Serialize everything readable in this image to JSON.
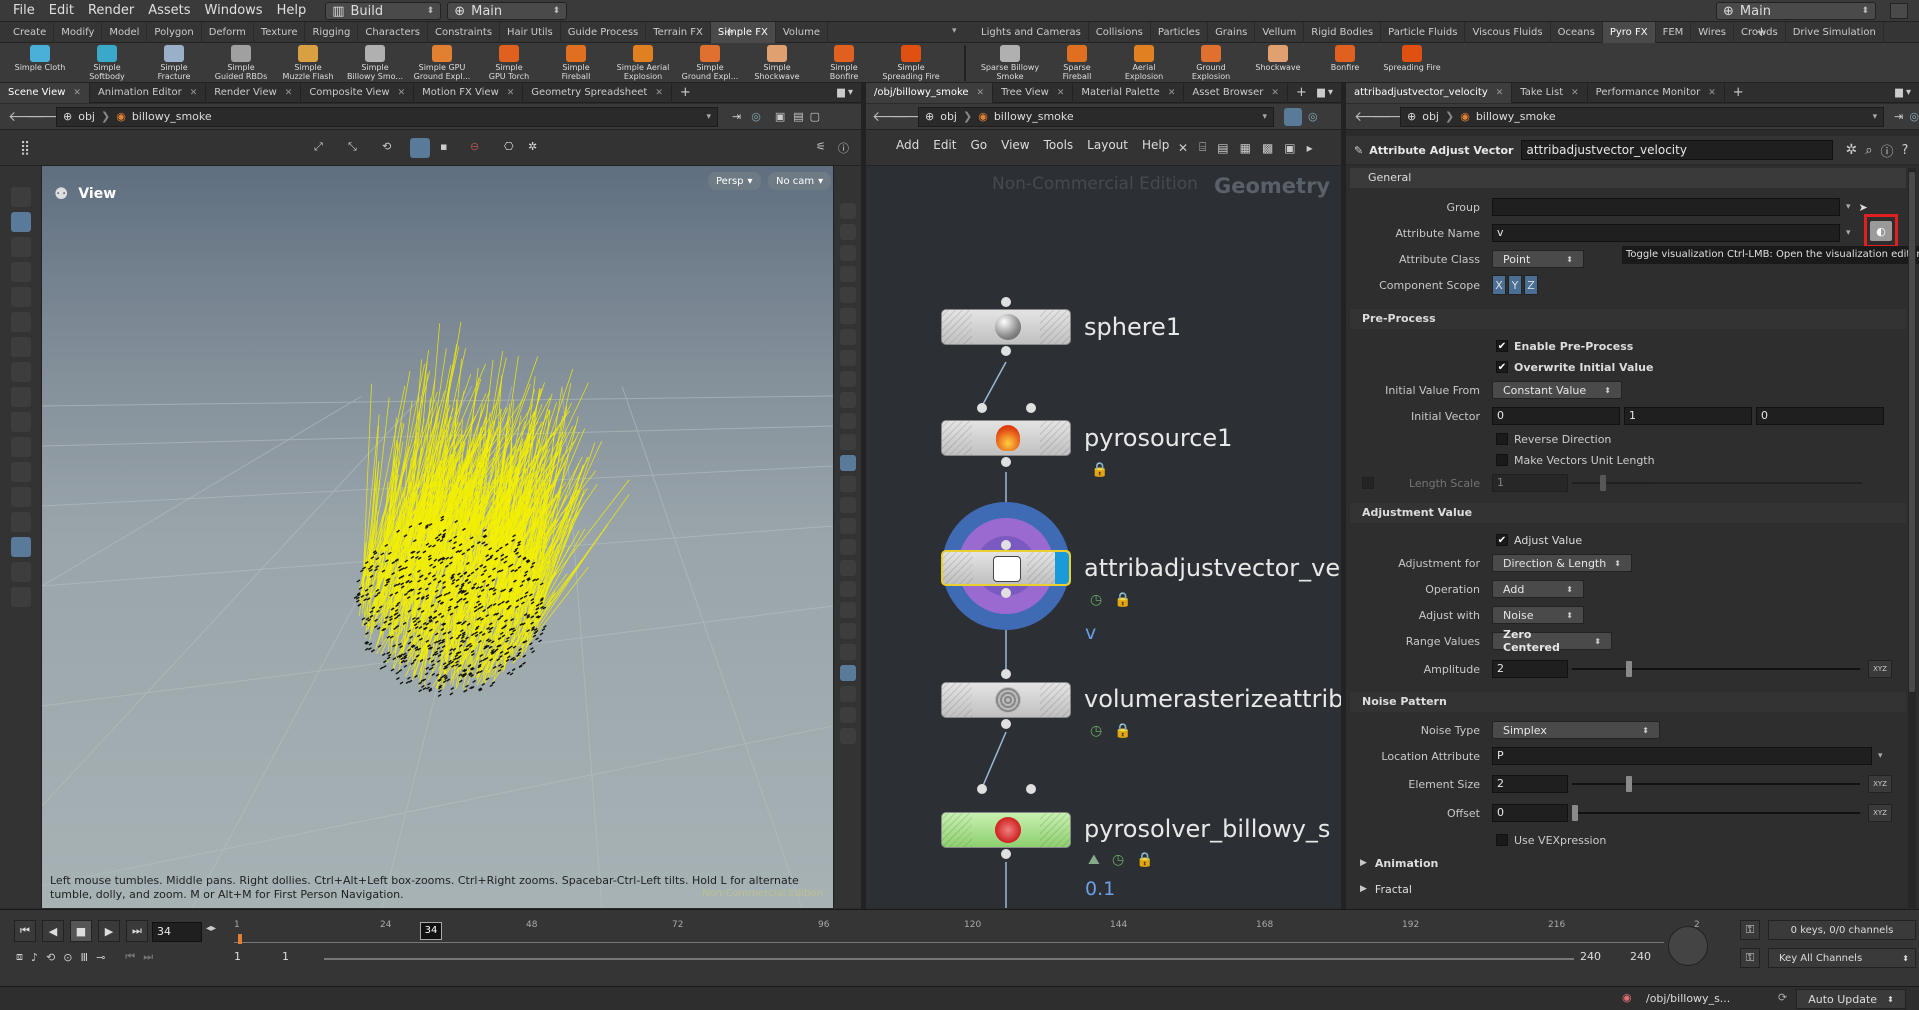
{
  "menubar": {
    "items": [
      "File",
      "Edit",
      "Render",
      "Assets",
      "Windows",
      "Help"
    ],
    "desktop": "Build",
    "network": "Main",
    "right_desktop": "Main"
  },
  "shelf_tabs_left": [
    "Create",
    "Modify",
    "Model",
    "Polygon",
    "Deform",
    "Texture",
    "Rigging",
    "Characters",
    "Constraints",
    "Hair Utils",
    "Guide Process",
    "Terrain FX",
    "Simple FX",
    "Volume"
  ],
  "shelf_tabs_left_active": "Simple FX",
  "shelf_tabs_right": [
    "Lights and Cameras",
    "Collisions",
    "Particles",
    "Grains",
    "Vellum",
    "Rigid Bodies",
    "Particle Fluids",
    "Viscous Fluids",
    "Oceans",
    "Pyro FX",
    "FEM",
    "Wires",
    "Crowds",
    "Drive Simulation"
  ],
  "shelf_tabs_right_active": "Pyro FX",
  "shelf_tools_left": [
    {
      "label": "Simple Cloth",
      "color": "#4ab0d8"
    },
    {
      "label": "Simple\nSoftbody",
      "color": "#3aa8c8"
    },
    {
      "label": "Simple\nFracture",
      "color": "#9ab0c8"
    },
    {
      "label": "Simple\nGuided RBDs",
      "color": "#a0a0a0"
    },
    {
      "label": "Simple\nMuzzle Flash",
      "color": "#d8a040"
    },
    {
      "label": "Simple\nBillowy Smo...",
      "color": "#b0b0b0"
    },
    {
      "label": "Simple GPU\nGround Expl...",
      "color": "#e08030"
    },
    {
      "label": "Simple\nGPU Torch",
      "color": "#e06020"
    },
    {
      "label": "Simple\nFireball",
      "color": "#e07020"
    },
    {
      "label": "Simple Aerial\nExplosion",
      "color": "#e08020"
    },
    {
      "label": "Simple\nGround Expl...",
      "color": "#e07030"
    },
    {
      "label": "Simple\nShockwave",
      "color": "#e0a070"
    },
    {
      "label": "Simple\nBonfire",
      "color": "#e06020"
    },
    {
      "label": "Simple\nSpreading Fire",
      "color": "#e05010"
    }
  ],
  "shelf_tools_right": [
    {
      "label": "Sparse Billowy\nSmoke",
      "color": "#b0b0b0"
    },
    {
      "label": "Sparse\nFireball",
      "color": "#e07020"
    },
    {
      "label": "Aerial\nExplosion",
      "color": "#e08020"
    },
    {
      "label": "Ground\nExplosion",
      "color": "#e07030"
    },
    {
      "label": "Shockwave",
      "color": "#e0a070"
    },
    {
      "label": "Bonfire",
      "color": "#e06020"
    },
    {
      "label": "Spreading Fire",
      "color": "#e05010"
    }
  ],
  "left_pane": {
    "tabs": [
      "Scene View",
      "Animation Editor",
      "Render View",
      "Composite View",
      "Motion FX View",
      "Geometry Spreadsheet"
    ],
    "active_tab": "Scene View",
    "path_root": "obj",
    "path_node": "billowy_smoke",
    "viewport_label": "View",
    "persp": "Persp",
    "cam": "No cam",
    "help_text": "Left mouse tumbles. Middle pans. Right dollies. Ctrl+Alt+Left box-zooms. Ctrl+Right zooms. Spacebar-Ctrl-Left tilts. Hold L for alternate tumble, dolly, and zoom. M or Alt+M for First Person Navigation.",
    "watermark": "Non-Commercial Edition"
  },
  "mid_pane": {
    "tabs": [
      "/obj/billowy_smoke",
      "Tree View",
      "Material Palette",
      "Asset Browser"
    ],
    "active_tab": "/obj/billowy_smoke",
    "path_root": "obj",
    "path_node": "billowy_smoke",
    "menu": [
      "Add",
      "Edit",
      "Go",
      "View",
      "Tools",
      "Layout",
      "Help"
    ],
    "watermark": "Non-Commercial Edition",
    "context": "Geometry",
    "nodes": [
      {
        "name": "sphere1",
        "sub": ""
      },
      {
        "name": "pyrosource1",
        "sub": ""
      },
      {
        "name": "attribadjustvector_ve",
        "sub": "v"
      },
      {
        "name": "volumerasterizeattrib",
        "sub": ""
      },
      {
        "name": "pyrosolver_billowy_s",
        "sub": "0.1"
      }
    ]
  },
  "right_pane": {
    "tabs": [
      "attribadjustvector_velocity",
      "Take List",
      "Performance Monitor"
    ],
    "active_tab": "attribadjustvector_velocity",
    "path_root": "obj",
    "path_node": "billowy_smoke",
    "node_type": "Attribute Adjust Vector",
    "node_name": "attribadjustvector_velocity",
    "tab_general": "General",
    "group_label": "Group",
    "group_value": "",
    "attrname_label": "Attribute Name",
    "attrname_value": "v",
    "tooltip": "Toggle visualization Ctrl-LMB: Open the visualization editor",
    "attrclass_label": "Attribute Class",
    "attrclass_value": "Point",
    "compscope_label": "Component Scope",
    "comps": [
      "X",
      "Y",
      "Z"
    ],
    "preprocess": "Pre-Process",
    "enable_pre": "Enable Pre-Process",
    "overwrite": "Overwrite Initial Value",
    "initfrom_label": "Initial Value From",
    "initfrom_value": "Constant Value",
    "initvec_label": "Initial Vector",
    "initvec": [
      "0",
      "1",
      "0"
    ],
    "reverse": "Reverse Direction",
    "unitlen": "Make Vectors Unit Length",
    "lenscale_label": "Length Scale",
    "lenscale_value": "1",
    "adjval": "Adjustment Value",
    "adjust_value": "Adjust Value",
    "adjfor_label": "Adjustment for",
    "adjfor_value": "Direction & Length",
    "op_label": "Operation",
    "op_value": "Add",
    "adjwith_label": "Adjust with",
    "adjwith_value": "Noise",
    "range_label": "Range Values",
    "range_value": "Zero Centered",
    "amp_label": "Amplitude",
    "amp_value": "2",
    "noisepat": "Noise Pattern",
    "ntype_label": "Noise Type",
    "ntype_value": "Simplex",
    "locattr_label": "Location Attribute",
    "locattr_value": "P",
    "elsize_label": "Element Size",
    "elsize_value": "2",
    "offset_label": "Offset",
    "offset_value": "0",
    "usevex": "Use VEXpression",
    "animation": "Animation",
    "fractal": "Fractal",
    "xyz": "XYZ"
  },
  "timeline": {
    "frame": "34",
    "marker": "34",
    "ticks": [
      "1",
      "24",
      "48",
      "72",
      "96",
      "120",
      "144",
      "168",
      "192",
      "216",
      "2"
    ],
    "start": "1",
    "start2": "1",
    "end": "240",
    "end2": "240",
    "keys": "0 keys, 0/0 channels",
    "key_all": "Key All Channels",
    "status_path": "/obj/billowy_s...",
    "auto_update": "Auto Update"
  }
}
